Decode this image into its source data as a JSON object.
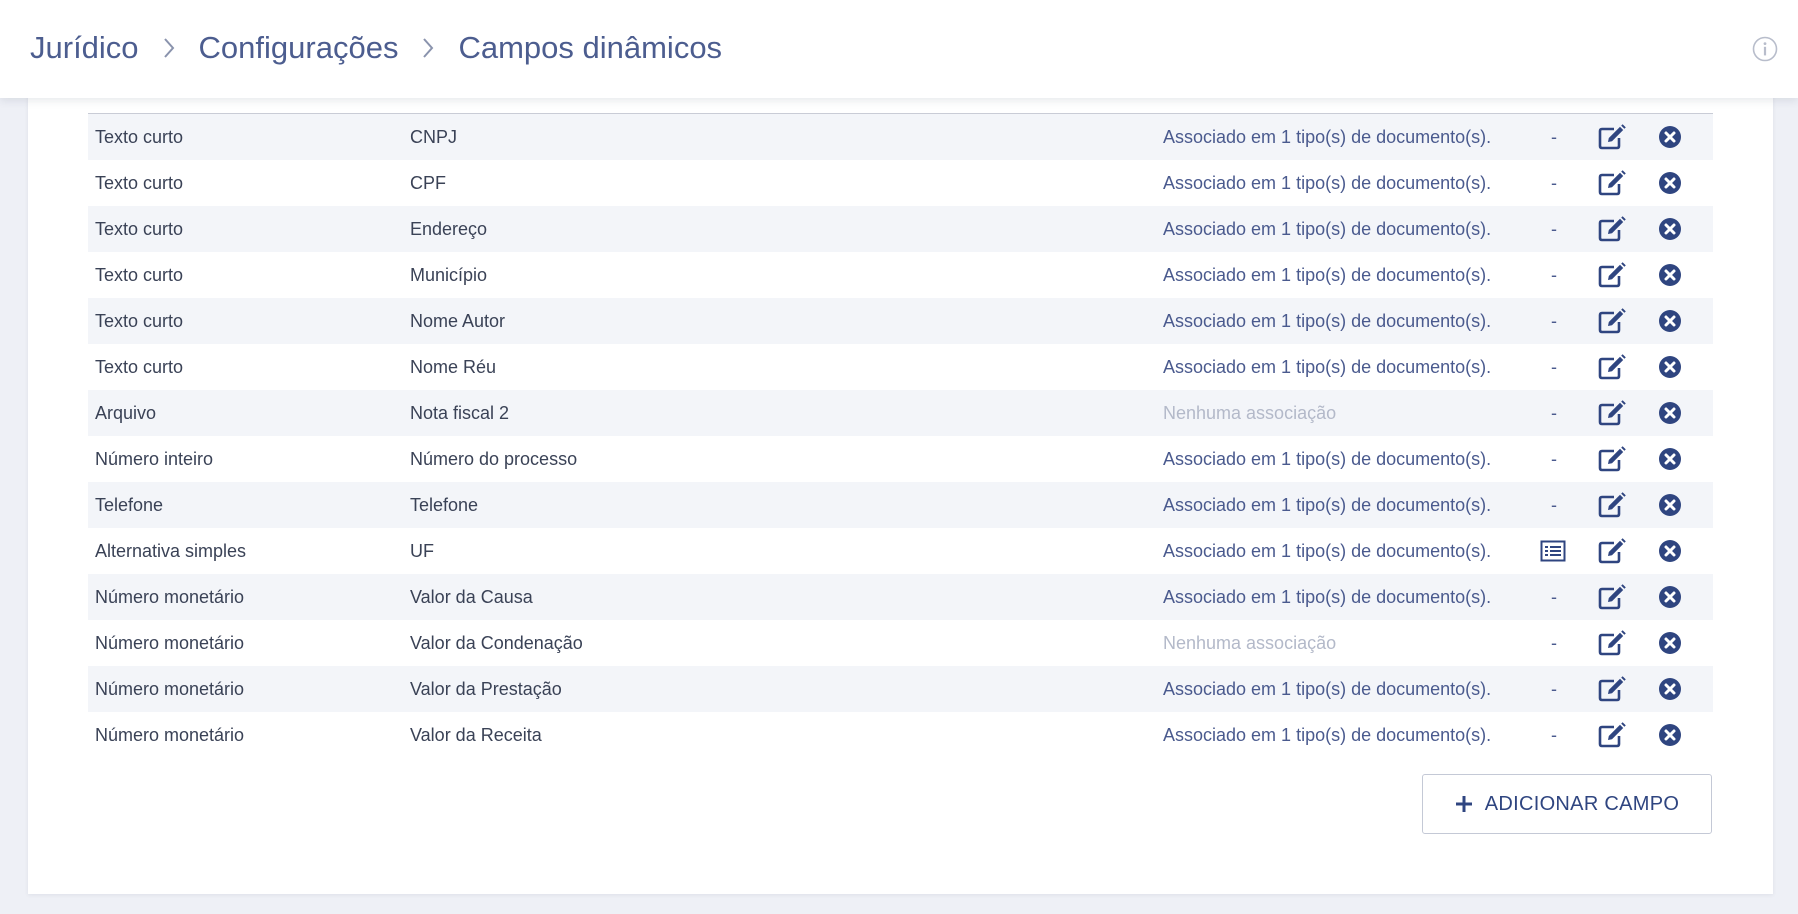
{
  "breadcrumb": [
    "Jurídico",
    "Configurações",
    "Campos dinâmicos"
  ],
  "add_button_label": "ADICIONAR CAMPO",
  "colors": {
    "accent": "#2f4580",
    "link": "#4c5d8f",
    "muted": "#b3b9c9",
    "stripe": "#f3f5f9"
  },
  "icons": {
    "breadcrumb_separator": "chevron-right-icon",
    "info": "info-icon",
    "edit": "edit-icon",
    "delete": "close-circle-icon",
    "options": "list-icon",
    "add": "plus-icon"
  },
  "rows": [
    {
      "type": "Texto curto",
      "name": "CNPJ",
      "association": "Associado em 1 tipo(s) de documento(s).",
      "muted": false,
      "options": "-"
    },
    {
      "type": "Texto curto",
      "name": "CPF",
      "association": "Associado em 1 tipo(s) de documento(s).",
      "muted": false,
      "options": "-"
    },
    {
      "type": "Texto curto",
      "name": "Endereço",
      "association": "Associado em 1 tipo(s) de documento(s).",
      "muted": false,
      "options": "-"
    },
    {
      "type": "Texto curto",
      "name": "Município",
      "association": "Associado em 1 tipo(s) de documento(s).",
      "muted": false,
      "options": "-"
    },
    {
      "type": "Texto curto",
      "name": "Nome Autor",
      "association": "Associado em 1 tipo(s) de documento(s).",
      "muted": false,
      "options": "-"
    },
    {
      "type": "Texto curto",
      "name": "Nome Réu",
      "association": "Associado em 1 tipo(s) de documento(s).",
      "muted": false,
      "options": "-"
    },
    {
      "type": "Arquivo",
      "name": "Nota fiscal 2",
      "association": "Nenhuma associação",
      "muted": true,
      "options": "-"
    },
    {
      "type": "Número inteiro",
      "name": "Número do processo",
      "association": "Associado em 1 tipo(s) de documento(s).",
      "muted": false,
      "options": "-"
    },
    {
      "type": "Telefone",
      "name": "Telefone",
      "association": "Associado em 1 tipo(s) de documento(s).",
      "muted": false,
      "options": "-"
    },
    {
      "type": "Alternativa simples",
      "name": "UF",
      "association": "Associado em 1 tipo(s) de documento(s).",
      "muted": false,
      "options": "list-icon"
    },
    {
      "type": "Número monetário",
      "name": "Valor da Causa",
      "association": "Associado em 1 tipo(s) de documento(s).",
      "muted": false,
      "options": "-"
    },
    {
      "type": "Número monetário",
      "name": "Valor da Condenação",
      "association": "Nenhuma associação",
      "muted": true,
      "options": "-"
    },
    {
      "type": "Número monetário",
      "name": "Valor da Prestação",
      "association": "Associado em 1 tipo(s) de documento(s).",
      "muted": false,
      "options": "-"
    },
    {
      "type": "Número monetário",
      "name": "Valor da Receita",
      "association": "Associado em 1 tipo(s) de documento(s).",
      "muted": false,
      "options": "-"
    }
  ]
}
